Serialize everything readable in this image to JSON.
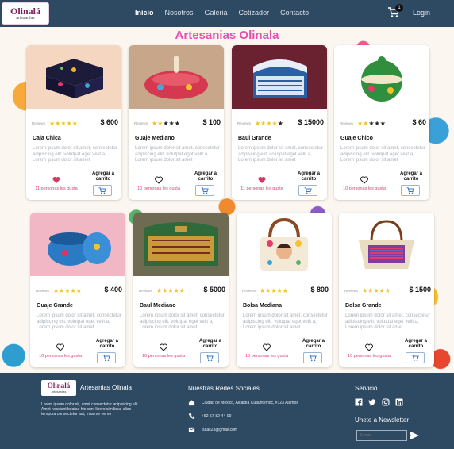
{
  "nav": {
    "logo_word": "Olinalá",
    "logo_sub": "artesanías",
    "links": [
      "Inicio",
      "Nosotros",
      "Galeria",
      "Cotizador",
      "Contacto"
    ],
    "cart_count": "1",
    "login": "Login"
  },
  "hero": {
    "title": "Artesanias Olinala"
  },
  "products": [
    {
      "name": "Caja Chica",
      "price": "$ 600",
      "stars": 5,
      "reviews_label": "Reviews",
      "desc": "Lorem ipsum dolor sit amet, consectetur adipiscing elit. volutpat eget velit a, Lorem ipsum dolor sit amet",
      "likes": "11 personas les gusta",
      "liked": true,
      "add_label": "Agregar a carrito",
      "image": "black lacquered chest"
    },
    {
      "name": "Guaje Mediano",
      "price": "$ 100",
      "stars": 2,
      "reviews_label": "Reviews",
      "desc": "Lorem ipsum dolor sit amet, consectetur adipiscing elit. volutpat eget velit a, Lorem ipsum dolor sit amet",
      "likes": "10 personas les gusta",
      "liked": false,
      "add_label": "Agregar a carrito",
      "image": "red painted gourd"
    },
    {
      "name": "Baul Grande",
      "price": "$ 15000",
      "stars": 4,
      "reviews_label": "Reviews",
      "desc": "Lorem ipsum dolor sit amet, consectetur adipiscing elit. volutpat eget velit a, Lorem ipsum dolor sit amet",
      "likes": "11 personas les gusta",
      "liked": true,
      "add_label": "Agregar a carrito",
      "image": "blue chest"
    },
    {
      "name": "Guaje Chico",
      "price": "$ 60",
      "stars": 2,
      "reviews_label": "Reviews",
      "desc": "Lorem ipsum dolor sit amet, consectetur adipiscing elit. volutpat eget velit a, Lorem ipsum dolor sit amet",
      "likes": "10 personas les gusta",
      "liked": false,
      "add_label": "Agregar a carrito",
      "image": "green gourd"
    },
    {
      "name": "Guaje Grande",
      "price": "$ 400",
      "stars": 5,
      "reviews_label": "Reviews",
      "desc": "Lorem ipsum dolor sit amet, consectetur adipiscing elit. volutpat eget velit a, Lorem ipsum dolor sit amet",
      "likes": "10 personas les gusta",
      "liked": false,
      "add_label": "Agregar a carrito",
      "image": "blue gourd bowl"
    },
    {
      "name": "Baul Mediano",
      "price": "$ 5000",
      "stars": 5,
      "reviews_label": "Reviews",
      "desc": "Lorem ipsum dolor sit amet, consectetur adipiscing elit. volutpat eget velit a, Lorem ipsum dolor sit amet",
      "likes": "10 personas les gusta",
      "liked": false,
      "add_label": "Agregar a carrito",
      "image": "green chest"
    },
    {
      "name": "Bolsa Mediana",
      "price": "$ 800",
      "stars": 5,
      "reviews_label": "Reviews",
      "desc": "Lorem ipsum dolor sit amet, consectetur adipiscing elit. volutpat eget velit a, Lorem ipsum dolor sit amet",
      "likes": "10 personas les gusta",
      "liked": false,
      "add_label": "Agregar a carrito",
      "image": "embroidered bag"
    },
    {
      "name": "Bolsa Grande",
      "price": "$ 1500",
      "stars": 5,
      "reviews_label": "Reviews",
      "desc": "Lorem ipsum dolor sit amet, consectetur adipiscing elit. volutpat eget velit a, Lorem ipsum dolor sit amet",
      "likes": "10 personas les gusta",
      "liked": false,
      "add_label": "Agregar a carrito",
      "image": "woven bag"
    }
  ],
  "footer": {
    "brand": "Artesanias Olinala",
    "about": "Lorem ipsum dolor sit, amet consectetur adipisicing elit. Amet nesciunt beatae hic sunt libero similique alias tempora consectetur aut, maxime nemo",
    "social_title": "Nuestras Redes Sociales",
    "address": "Ciudad de México, Alcaldía Cuauhtemoc, #123 Alamos",
    "phone": "+52-57-82-44-99",
    "email": "lsaac23@gmail.com",
    "service_title": "Servicio",
    "newsletter_title": "Unete a Newsletter",
    "email_placeholder": "Email"
  },
  "colors": {
    "nav_bg": "#2e4a63",
    "title_pink": "#e84fb3",
    "like_pink": "#e0407a",
    "star": "#f2c12e"
  }
}
